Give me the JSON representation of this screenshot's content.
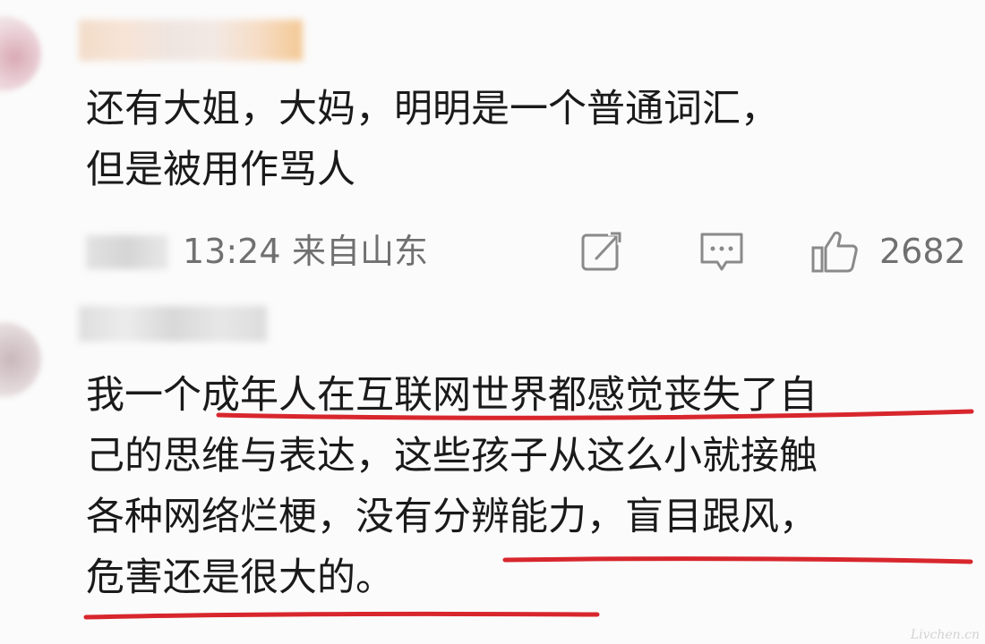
{
  "comments": [
    {
      "text": "还有大姐，大妈，明明是一个普通词汇，\n但是被用作骂人",
      "time": "13:24",
      "location": "来自山东",
      "like_count": "2682",
      "actions": {
        "share_icon": "share-icon",
        "reply_icon": "reply-icon",
        "like_icon": "thumbs-up-icon"
      }
    },
    {
      "text": "我一个成年人在互联网世界都感觉丧失了自\n己的思维与表达，这些孩子从这么小就接触\n各种网络烂梗，没有分辨能力，盲目跟风，\n危害还是很大的。",
      "annotation_color": "#d8262d"
    }
  ],
  "watermark": "Livchen.cn"
}
